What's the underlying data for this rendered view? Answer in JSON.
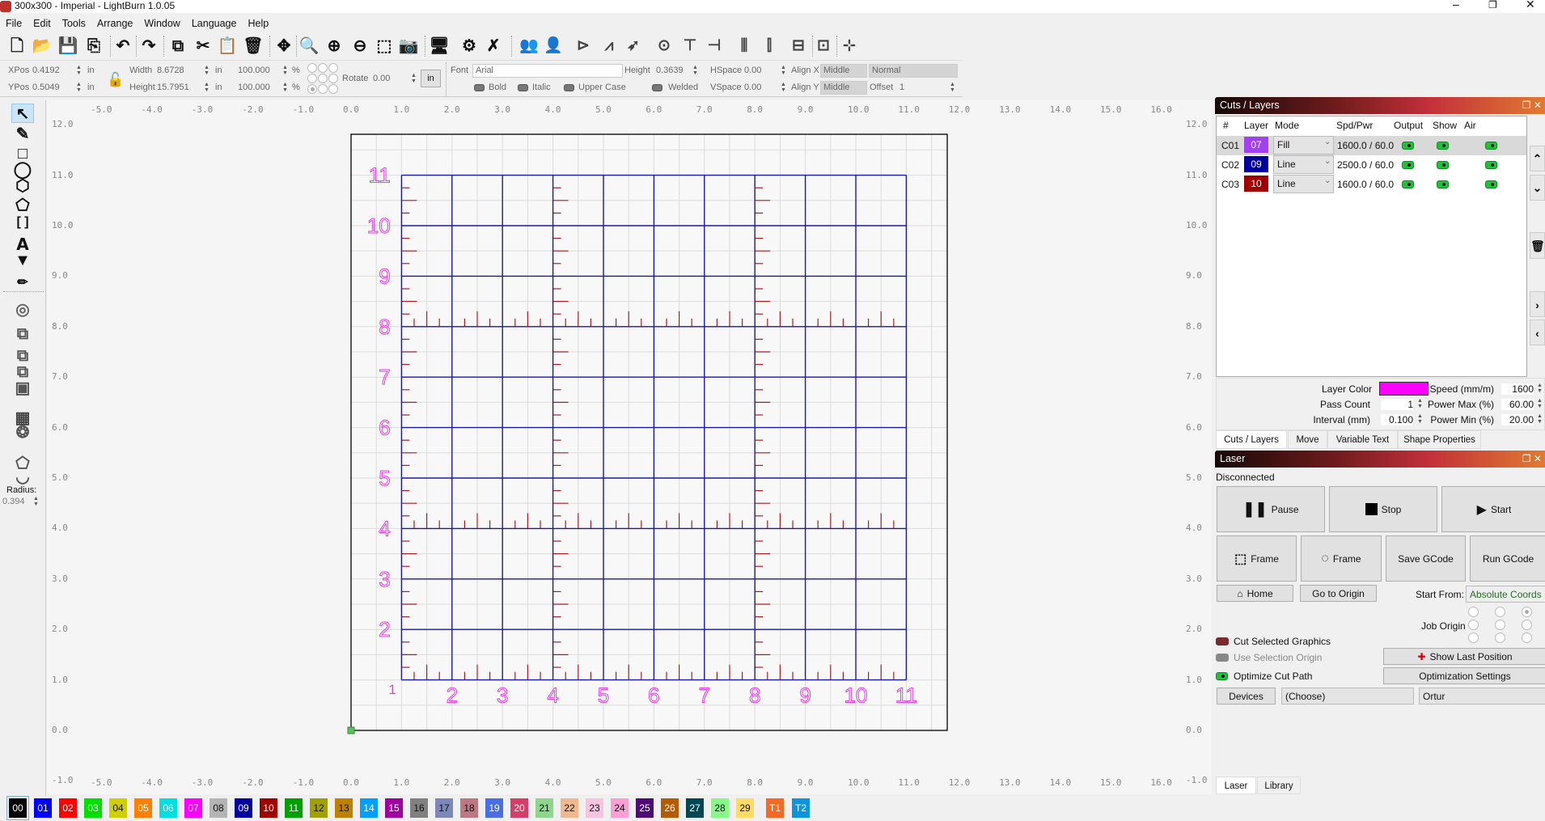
{
  "window": {
    "title": "300x300 - Imperial - LightBurn 1.0.05"
  },
  "menu": [
    "File",
    "Edit",
    "Tools",
    "Arrange",
    "Window",
    "Language",
    "Help"
  ],
  "toolbar": [
    "new-file",
    "open-file",
    "save-file",
    "import",
    "undo",
    "redo",
    "copy",
    "cut",
    "paste",
    "delete",
    "move-tool",
    "zoom-to-page",
    "zoom-in",
    "zoom-out",
    "zoom-to-selection",
    "camera",
    "devices-monitor",
    "machine-settings",
    "tools",
    "group",
    "ungroup",
    "flip-horizontal",
    "mirror",
    "rotate",
    "center-origin",
    "align-top",
    "align-left",
    "distribute-horizontal",
    "distribute-vertical",
    "make-same-width",
    "make-same-height",
    "move-laser"
  ],
  "propbar": {
    "xpos_label": "XPos",
    "xpos": "0.4192",
    "ypos_label": "YPos",
    "ypos": "0.5049",
    "unit": "in",
    "width_label": "Width",
    "width": "8.6728",
    "height_label": "Height",
    "height": "15.7951",
    "scale_w": "100.000",
    "scale_h": "100.000",
    "percent": "%",
    "rotate_label": "Rotate",
    "rotate": "0.00",
    "in_button": "in",
    "font_label": "Font",
    "font": "Arial",
    "text_height_label": "Height",
    "text_height": "0.3639",
    "hspace_label": "HSpace",
    "hspace": "0.00",
    "vspace_label": "VSpace",
    "vspace": "0.00",
    "alignx_label": "Align X",
    "alignx": "Middle",
    "aligny_label": "Align Y",
    "aligny": "Middle",
    "style": "Normal",
    "offset_label": "Offset",
    "offset": "1",
    "bold": "Bold",
    "italic": "Italic",
    "upper": "Upper Case",
    "welded": "Welded"
  },
  "left_toolbar": {
    "radius_label": "Radius:",
    "radius": "0.394"
  },
  "rulers": {
    "x_ticks": [
      "-5.0",
      "-4.0",
      "-3.0",
      "-2.0",
      "-1.0",
      "0.0",
      "1.0",
      "2.0",
      "3.0",
      "4.0",
      "5.0",
      "6.0",
      "7.0",
      "8.0",
      "9.0",
      "10.0",
      "11.0",
      "12.0",
      "13.0",
      "14.0",
      "15.0",
      "16.0"
    ],
    "y_ticks": [
      "12.0",
      "11.0",
      "10.0",
      "9.0",
      "8.0",
      "7.0",
      "6.0",
      "5.0",
      "4.0",
      "3.0",
      "2.0",
      "1.0",
      "0.0",
      "-1.0"
    ]
  },
  "design": {
    "row_labels": [
      "11",
      "10",
      "9",
      "8",
      "7",
      "6",
      "5",
      "4",
      "3",
      "2"
    ],
    "col_labels": [
      "2",
      "3",
      "4",
      "5",
      "6",
      "7",
      "8",
      "9",
      "10",
      "11"
    ],
    "corner_label": "1"
  },
  "cuts": {
    "title": "Cuts / Layers",
    "headers": [
      "#",
      "Layer",
      "Mode",
      "Spd/Pwr",
      "Output",
      "Show",
      "Air"
    ],
    "rows": [
      {
        "id": "C01",
        "layer": "07",
        "color": "#a040f0",
        "mode": "Fill",
        "spdpwr": "1600.0 / 60.0"
      },
      {
        "id": "C02",
        "layer": "09",
        "color": "#0000a0",
        "mode": "Line",
        "spdpwr": "2500.0 / 60.0"
      },
      {
        "id": "C03",
        "layer": "10",
        "color": "#a00000",
        "mode": "Line",
        "spdpwr": "1600.0 / 60.0"
      }
    ],
    "layer_color_label": "Layer Color",
    "layer_color": "#ff00ff",
    "speed_label": "Speed (mm/m)",
    "speed": "1600",
    "pass_label": "Pass Count",
    "pass": "1",
    "powmax_label": "Power Max (%)",
    "powmax": "60.00",
    "interval_label": "Interval (mm)",
    "interval": "0.100",
    "powmin_label": "Power Min (%)",
    "powmin": "20.00",
    "tabs": [
      "Cuts / Layers",
      "Move",
      "Variable Text",
      "Shape Properties"
    ]
  },
  "laser": {
    "title": "Laser",
    "status": "Disconnected",
    "pause": "Pause",
    "stop": "Stop",
    "start": "Start",
    "frame1": "Frame",
    "frame2": "Frame",
    "save_gcode": "Save GCode",
    "run_gcode": "Run GCode",
    "home": "Home",
    "go_origin": "Go to Origin",
    "start_from_label": "Start From:",
    "start_from": "Absolute Coords",
    "job_origin_label": "Job Origin",
    "cut_selected": "Cut Selected Graphics",
    "use_selection_origin": "Use Selection Origin",
    "optimize": "Optimize Cut Path",
    "show_last": "Show Last Position",
    "opt_settings": "Optimization Settings",
    "devices": "Devices",
    "device_choice": "(Choose)",
    "device": "Ortur",
    "tabs": [
      "Laser",
      "Library"
    ]
  },
  "palette": [
    {
      "label": "00",
      "color": "#000000"
    },
    {
      "label": "01",
      "color": "#0000ff"
    },
    {
      "label": "02",
      "color": "#ff0000"
    },
    {
      "label": "03",
      "color": "#00e000"
    },
    {
      "label": "04",
      "color": "#d0d000"
    },
    {
      "label": "05",
      "color": "#ff8000"
    },
    {
      "label": "06",
      "color": "#00e0e0"
    },
    {
      "label": "07",
      "color": "#ff00ff"
    },
    {
      "label": "08",
      "color": "#b4b4b4"
    },
    {
      "label": "09",
      "color": "#0000a0"
    },
    {
      "label": "10",
      "color": "#a00000"
    },
    {
      "label": "11",
      "color": "#00a000"
    },
    {
      "label": "12",
      "color": "#a0a000"
    },
    {
      "label": "13",
      "color": "#c08000"
    },
    {
      "label": "14",
      "color": "#00a0ff"
    },
    {
      "label": "15",
      "color": "#a000a0"
    },
    {
      "label": "16",
      "color": "#808080"
    },
    {
      "label": "17",
      "color": "#7d87b9"
    },
    {
      "label": "18",
      "color": "#bb7784"
    },
    {
      "label": "19",
      "color": "#4a6fe3"
    },
    {
      "label": "20",
      "color": "#d33f6a"
    },
    {
      "label": "21",
      "color": "#8cd78c"
    },
    {
      "label": "22",
      "color": "#f0b98d"
    },
    {
      "label": "23",
      "color": "#f6c4e1"
    },
    {
      "label": "24",
      "color": "#fa9ed4"
    },
    {
      "label": "25",
      "color": "#500a78"
    },
    {
      "label": "26",
      "color": "#b45a00"
    },
    {
      "label": "27",
      "color": "#004754"
    },
    {
      "label": "28",
      "color": "#86fa88"
    },
    {
      "label": "29",
      "color": "#ffdb66"
    },
    {
      "label": "T1",
      "color": "#f36926"
    },
    {
      "label": "T2",
      "color": "#0c94dc"
    }
  ]
}
